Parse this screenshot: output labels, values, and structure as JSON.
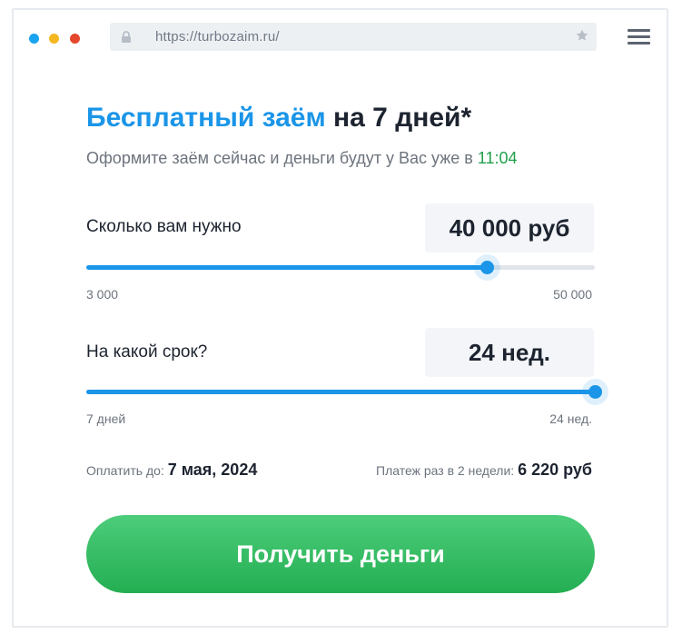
{
  "browser": {
    "url": "https://turbozaim.ru/",
    "window_dots": [
      "#1aa3f0",
      "#f5b821",
      "#e4472b"
    ],
    "icons": [
      "lock-icon",
      "star-icon",
      "hamburger-menu-icon"
    ]
  },
  "header": {
    "title_accent": "Бесплатный заём",
    "title_rest": "на 7 дней*",
    "subtitle_prefix": "Оформите заём сейчас и деньги будут у Вас уже в",
    "subtitle_time": "11:04"
  },
  "amount": {
    "label": "Сколько вам нужно",
    "display": "40 000 руб",
    "value": 40000,
    "min": 3000,
    "max": 50000,
    "min_label": "3 000",
    "max_label": "50 000"
  },
  "term": {
    "label": "На какой срок?",
    "display": "24 нед.",
    "value_weeks": 24,
    "min_weeks": 1,
    "max_weeks": 24,
    "min_label": "7 дней",
    "max_label": "24 нед."
  },
  "summary": {
    "due_label": "Оплатить до:",
    "due_value": "7 мая, 2024",
    "payment_label": "Платеж раз в 2 недели:",
    "payment_value": "6 220 руб"
  },
  "cta": {
    "label": "Получить деньги"
  },
  "colors": {
    "accent": "#1a95e8",
    "success": "#21a04c",
    "button": "#2fb85e"
  }
}
